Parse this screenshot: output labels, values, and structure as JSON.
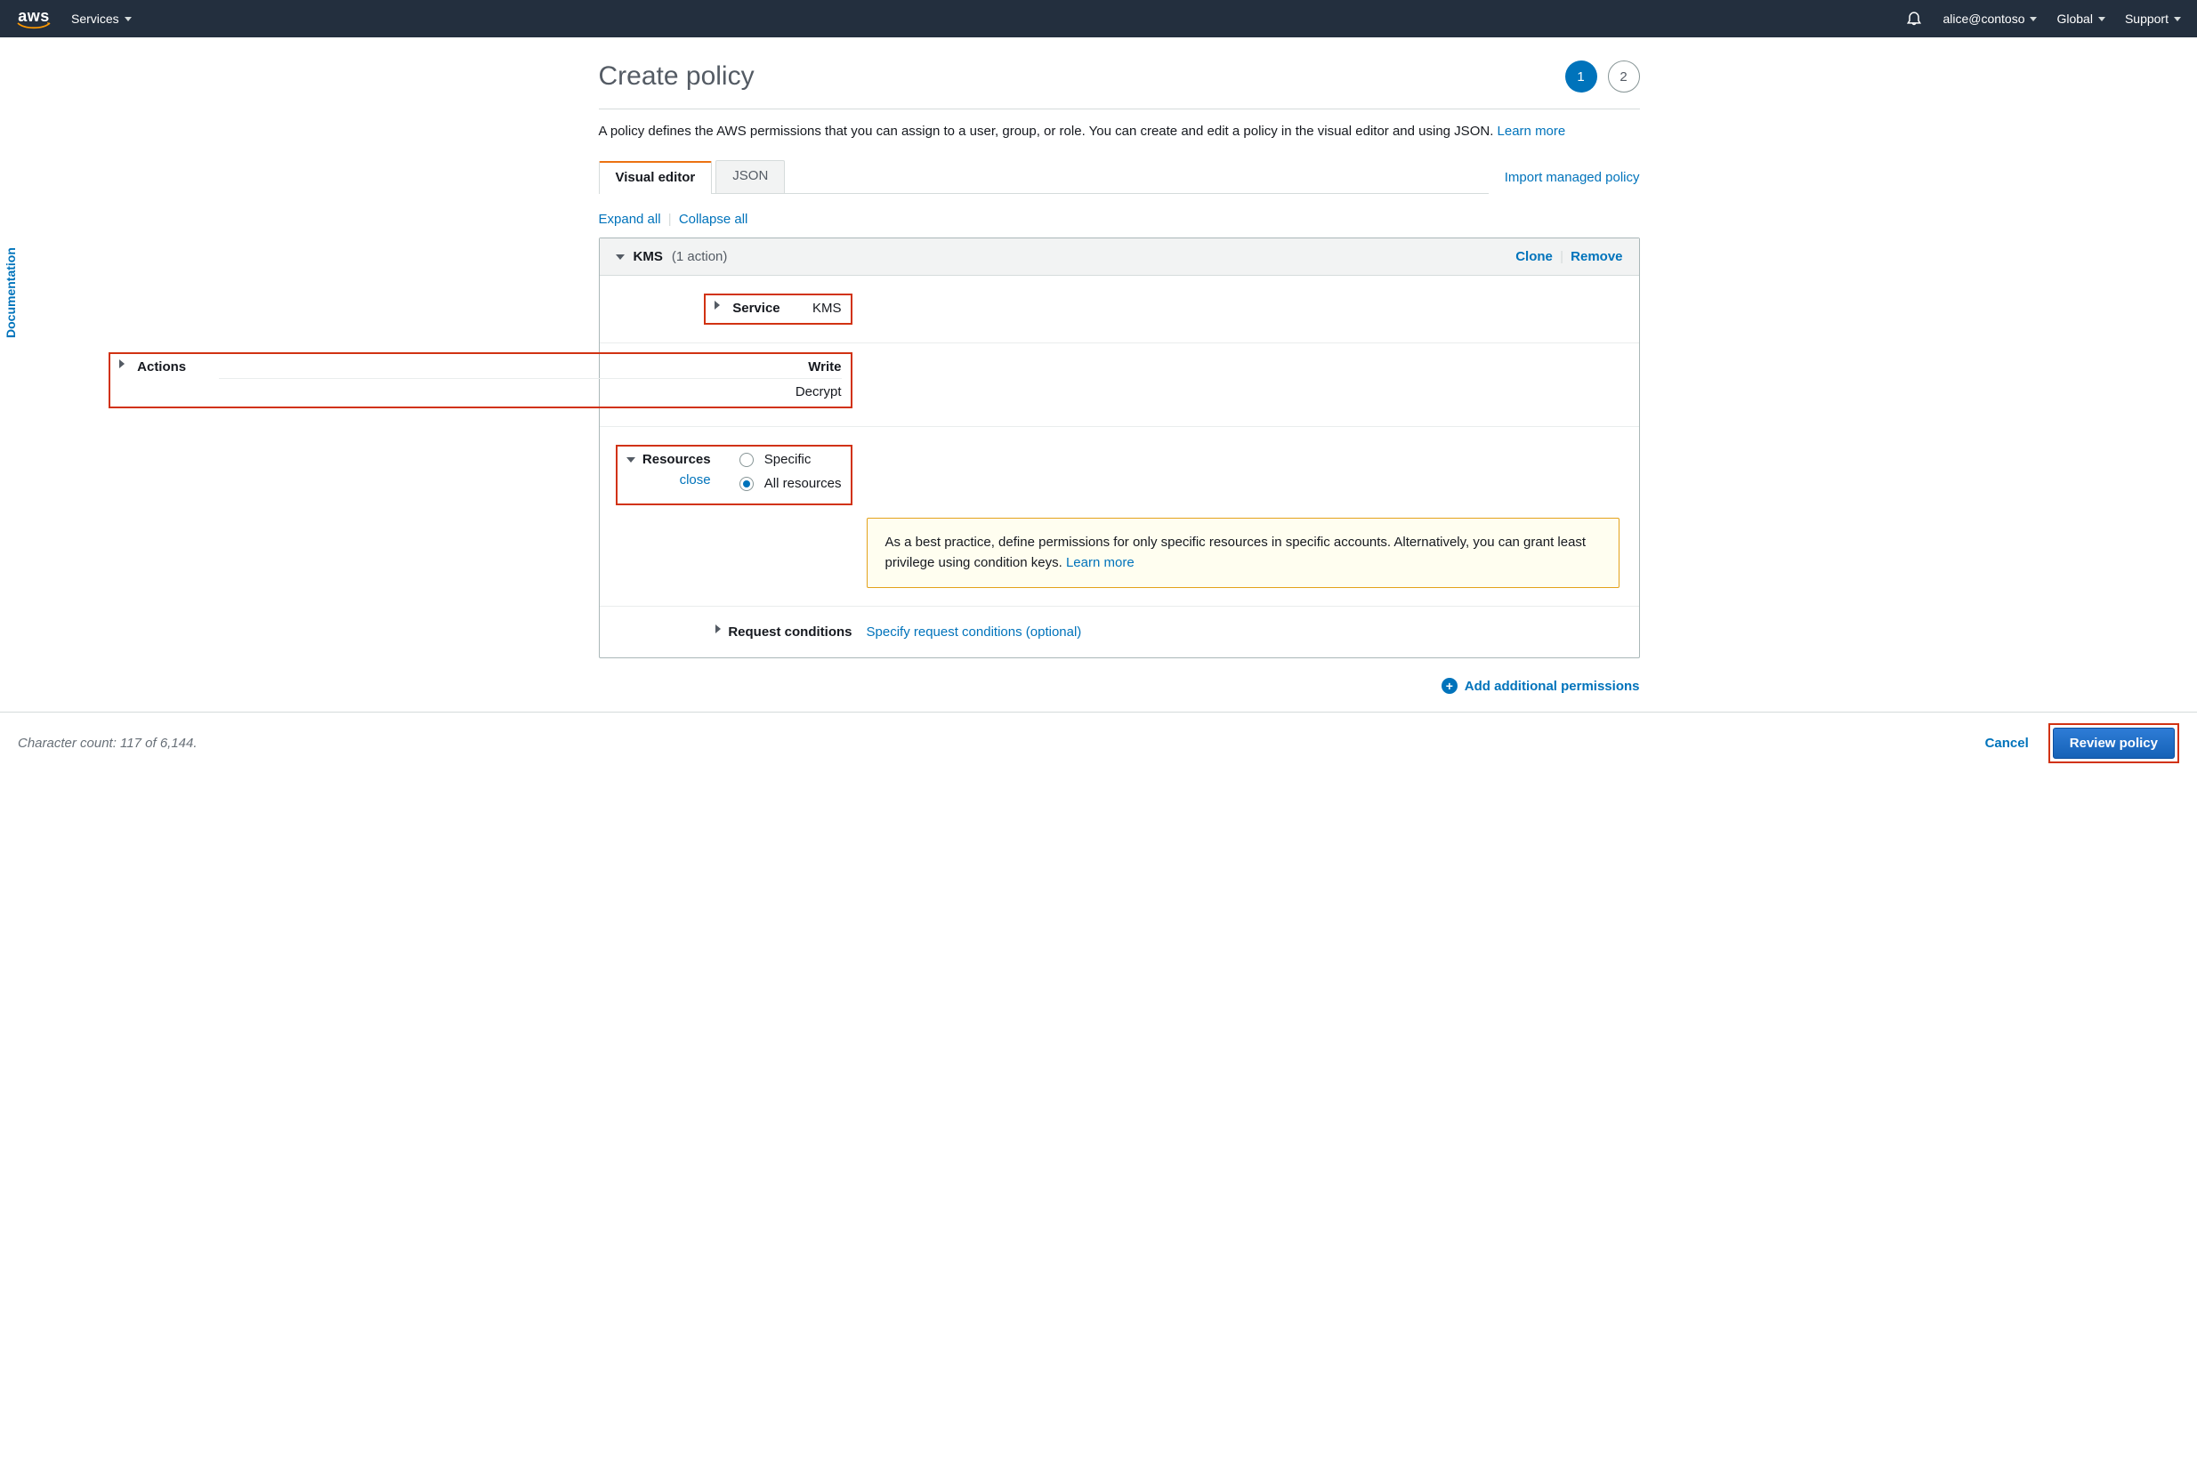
{
  "nav": {
    "brand": "aws",
    "services": "Services",
    "user": "alice@contoso",
    "region": "Global",
    "support": "Support"
  },
  "sideTab": "Documentation",
  "page": {
    "title": "Create policy",
    "step1": "1",
    "step2": "2",
    "intro_a": "A policy defines the AWS permissions that you can assign to a user, group, or role. You can create and edit a policy in the visual editor and using JSON. ",
    "intro_learn": "Learn more"
  },
  "tabs": {
    "visual": "Visual editor",
    "json": "JSON",
    "import": "Import managed policy"
  },
  "expand": {
    "expand": "Expand all",
    "collapse": "Collapse all"
  },
  "block": {
    "service": "KMS",
    "count": "(1 action)",
    "clone": "Clone",
    "remove": "Remove",
    "service_label": "Service",
    "service_value": "KMS",
    "actions_label": "Actions",
    "actions_write": "Write",
    "actions_decrypt": "Decrypt",
    "resources_label": "Resources",
    "resources_close": "close",
    "res_specific": "Specific",
    "res_all": "All resources",
    "info_a": "As a best practice, define permissions for only specific resources in specific accounts. Alternatively, you can grant least privilege using condition keys. ",
    "info_learn": "Learn more",
    "reqcond_label": "Request conditions",
    "reqcond_link": "Specify request conditions (optional)"
  },
  "addPerms": "Add additional permissions",
  "footer": {
    "char": "Character count: 117 of 6,144.",
    "cancel": "Cancel",
    "review": "Review policy"
  }
}
